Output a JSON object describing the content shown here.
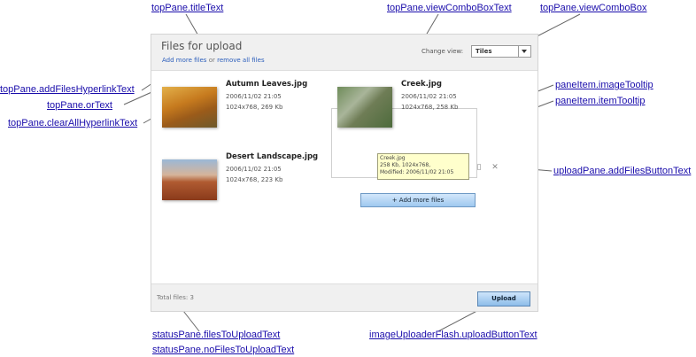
{
  "top_pane": {
    "title": "Files for upload",
    "add_link": "Add more files",
    "or_text": "or",
    "remove_link": "remove all files",
    "change_view_label": "Change view:",
    "view_combo_value": "Tiles"
  },
  "items": [
    {
      "name": "Autumn Leaves.jpg",
      "date": "2006/11/02 21:05",
      "info": "1024x768, 269 Kb"
    },
    {
      "name": "Creek.jpg",
      "date": "2006/11/02 21:05",
      "info": "1024x768, 258 Kb"
    },
    {
      "name": "Desert Landscape.jpg",
      "date": "2006/11/02 21:05",
      "info": "1024x768, 223 Kb"
    }
  ],
  "tooltip": {
    "line1": "Creek.jpg",
    "line2": "258 Kb, 1024x768,",
    "line3": "Modified: 2006/11/02 21:05"
  },
  "add_files_button": "+ Add more files",
  "status": {
    "label": "Total files:",
    "count": "3"
  },
  "upload_button": "Upload",
  "callouts": {
    "title_text": "topPane.titleText",
    "view_combo_text": "topPane.viewComboBoxText",
    "view_combo": "topPane.viewComboBox",
    "add_files_link": "topPane.addFilesHyperlinkText",
    "or_text": "topPane.orText",
    "clear_all": "topPane.clearAllHyperlinkText",
    "image_tooltip": "paneItem.imageTooltip",
    "item_tooltip": "paneItem.itemTooltip",
    "add_files_button": "uploadPane.addFilesButtonText",
    "files_to_upload": "statusPane.filesToUploadText",
    "no_files": "statusPane.noFilesToUploadText",
    "upload_button": "imageUploaderFlash.uploadButtonText"
  }
}
